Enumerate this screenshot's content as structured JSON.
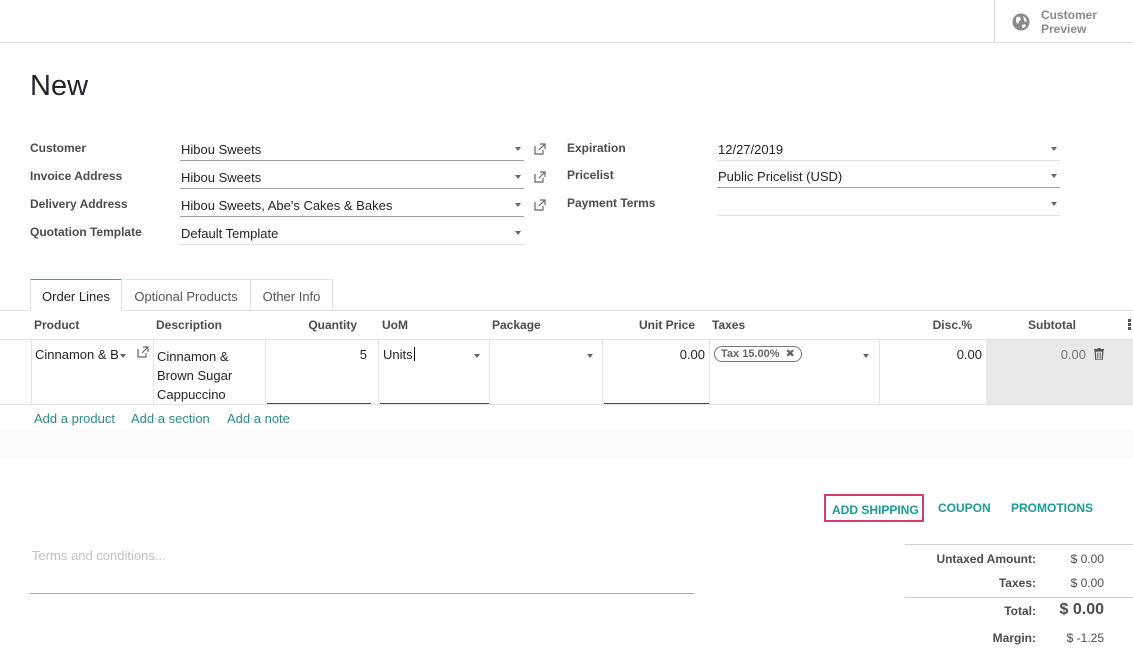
{
  "topbar": {
    "preview_line1": "Customer",
    "preview_line2": "Preview"
  },
  "title": "New",
  "form": {
    "customer_label": "Customer",
    "customer_value": "Hibou Sweets",
    "invoice_label": "Invoice Address",
    "invoice_value": "Hibou Sweets",
    "delivery_label": "Delivery Address",
    "delivery_value": "Hibou Sweets, Abe's Cakes & Bakes",
    "template_label": "Quotation Template",
    "template_value": "Default Template",
    "expiration_label": "Expiration",
    "expiration_value": "12/27/2019",
    "pricelist_label": "Pricelist",
    "pricelist_value": "Public Pricelist (USD)",
    "payment_label": "Payment Terms",
    "payment_value": ""
  },
  "tabs": [
    "Order Lines",
    "Optional Products",
    "Other Info"
  ],
  "table": {
    "headers": {
      "product": "Product",
      "description": "Description",
      "quantity": "Quantity",
      "uom": "UoM",
      "package": "Package",
      "unit_price": "Unit Price",
      "taxes": "Taxes",
      "disc": "Disc.%",
      "subtotal": "Subtotal"
    },
    "row": {
      "product": "Cinnamon & B",
      "description_1": "Cinnamon &",
      "description_2": "Brown Sugar",
      "description_3": "Cappuccino",
      "quantity": "5",
      "uom": "Units",
      "package": "",
      "unit_price": "0.00",
      "tax_tag": "Tax 15.00%",
      "disc": "0.00",
      "subtotal": "0.00"
    },
    "actions": {
      "add_product": "Add a product",
      "add_section": "Add a section",
      "add_note": "Add a note"
    }
  },
  "buttons": {
    "add_shipping": "ADD SHIPPING",
    "coupon": "COUPON",
    "promotions": "PROMOTIONS"
  },
  "terms_placeholder": "Terms and conditions...",
  "totals": {
    "untaxed_label": "Untaxed Amount:",
    "untaxed_value": "$ 0.00",
    "taxes_label": "Taxes:",
    "taxes_value": "$ 0.00",
    "total_label": "Total:",
    "total_value": "$ 0.00",
    "margin_label": "Margin:",
    "margin_value": "$ -1.25"
  }
}
